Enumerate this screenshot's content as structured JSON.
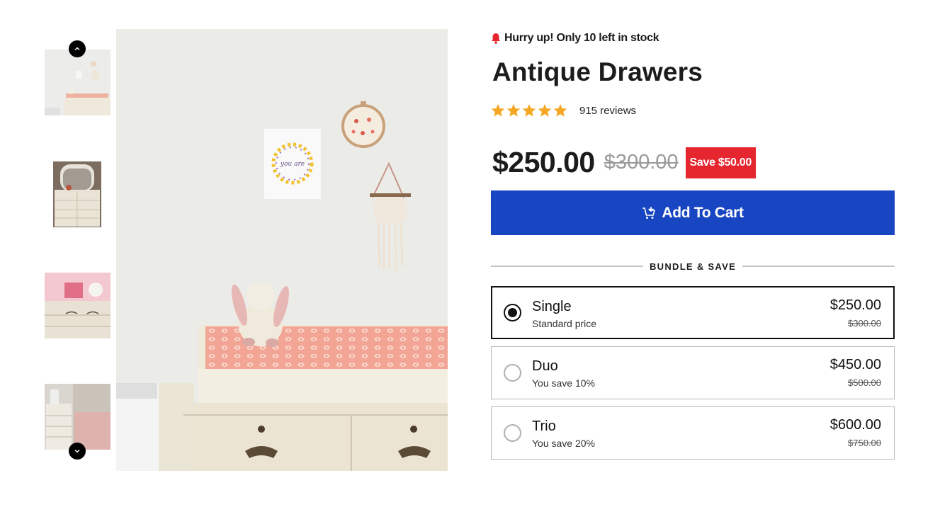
{
  "stock": {
    "message": "Hurry up! Only 10 left in stock",
    "icon": "bell-icon",
    "icon_color": "#e5262f"
  },
  "product": {
    "title": "Antique Drawers",
    "rating": 5,
    "rating_max": 5,
    "reviews_label": "915 reviews",
    "price": "$250.00",
    "compare_price": "$300.00",
    "save_label": "Save $50.00"
  },
  "cart": {
    "button_label": "Add To Cart",
    "icon": "cart-add-icon"
  },
  "bundle": {
    "heading": "BUNDLE & SAVE",
    "options": [
      {
        "name": "Single",
        "subtitle": "Standard price",
        "price": "$250.00",
        "compare_price": "$300.00",
        "selected": true
      },
      {
        "name": "Duo",
        "subtitle": "You save 10%",
        "price": "$450.00",
        "compare_price": "$500.00",
        "selected": false
      },
      {
        "name": "Trio",
        "subtitle": "You save 20%",
        "price": "$600.00",
        "compare_price": "$750.00",
        "selected": false
      }
    ]
  },
  "gallery": {
    "thumbnail_count": 4,
    "active_index": 0,
    "prev_icon": "chevron-up-icon",
    "next_icon": "chevron-down-icon"
  },
  "colors": {
    "accent_button": "#1845c1",
    "save_badge": "#e5262f",
    "star": "#f5a623"
  }
}
